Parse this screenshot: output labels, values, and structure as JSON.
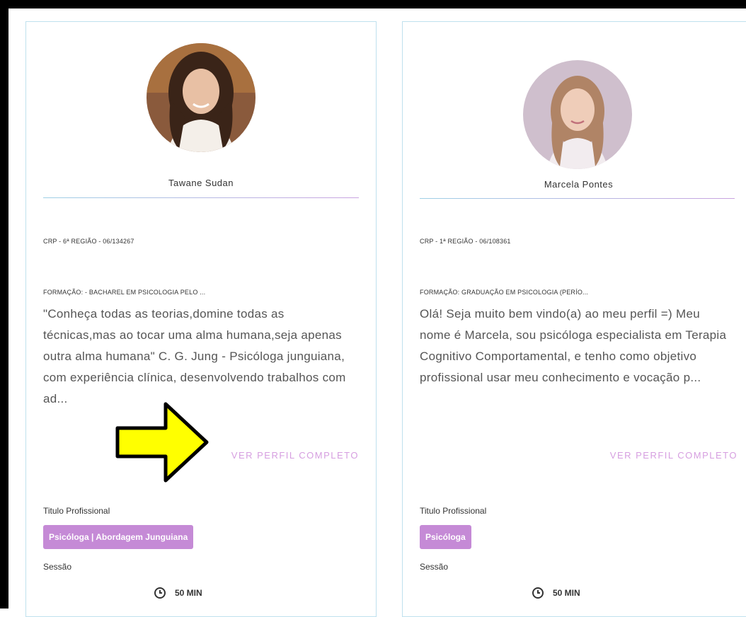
{
  "cards": [
    {
      "name": "Tawane Sudan",
      "crp": "CRP - 6ª REGIÃO - 06/134267",
      "formacao": "FORMAÇÃO: - BACHAREL EM PSICOLOGIA PELO ...",
      "description": "\"Conheça todas as teorias,domine todas as técnicas,mas ao tocar uma alma humana,seja apenas outra alma humana\" C. G. Jung - Psicóloga junguiana, com experiência clínica, desenvolvendo trabalhos com ad...",
      "ver_perfil": "VER PERFIL COMPLETO",
      "titulo_label": "Titulo Profissional",
      "titulo_tag": "Psicóloga | Abordagem Junguiana",
      "sessao_label": "Sessão",
      "duracao": "50 MIN"
    },
    {
      "name": "Marcela Pontes",
      "crp": "CRP - 1ª REGIÃO - 06/108361",
      "formacao": "FORMAÇÃO: GRADUAÇÃO EM PSICOLOGIA (PERÍO...",
      "description": "Olá! Seja muito bem vindo(a) ao meu perfil =) Meu nome é Marcela, sou psicóloga especialista em Terapia Cognitivo Comportamental, e tenho como objetivo profissional usar meu conhecimento e vocação p...",
      "ver_perfil": "VER PERFIL COMPLETO",
      "titulo_label": "Titulo Profissional",
      "titulo_tag": "Psicóloga",
      "sessao_label": "Sessão",
      "duracao": "50 MIN"
    }
  ],
  "colors": {
    "accent": "#c58ad6",
    "link": "#d69ee0",
    "border": "#bfe1ee",
    "arrow": "#ffff00"
  },
  "icons": {
    "clock": "clock-icon",
    "arrow": "arrow-right-icon"
  }
}
